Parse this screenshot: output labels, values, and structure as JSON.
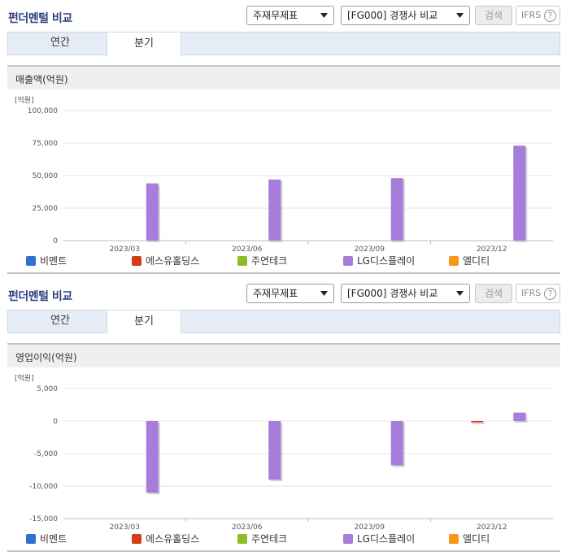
{
  "panels": [
    {
      "title": "펀더멘털 비교",
      "report_select": "주재무제표",
      "group_select": "[FG000] 경쟁사 비교",
      "search_label": "검색",
      "ifrs_label": "IFRS",
      "help_glyph": "?",
      "tabs": [
        "연간",
        "분기"
      ],
      "active_tab": "분기",
      "section_title": "매출액(억원)",
      "unit_label": "[억원]",
      "legend": [
        {
          "name": "비멘트",
          "color": "#2f6fd6"
        },
        {
          "name": "에스유홀딩스",
          "color": "#d93a1b"
        },
        {
          "name": "주연테크",
          "color": "#8dbe24"
        },
        {
          "name": "LG디스플레이",
          "color": "#a77ddb"
        },
        {
          "name": "엘디티",
          "color": "#f59a16"
        }
      ],
      "chart_data": {
        "type": "bar",
        "categories": [
          "2023/03",
          "2023/06",
          "2023/09",
          "2023/12"
        ],
        "y_ticks": [
          "100,000",
          "75,000",
          "50,000",
          "25,000",
          "0"
        ],
        "ylim": [
          0,
          100000
        ],
        "series": [
          {
            "name": "LG디스플레이",
            "color": "#a77ddb",
            "values": [
              44000,
              47000,
              48000,
              73000
            ]
          }
        ]
      }
    },
    {
      "title": "펀더멘털 비교",
      "report_select": "주재무제표",
      "group_select": "[FG000] 경쟁사 비교",
      "search_label": "검색",
      "ifrs_label": "IFRS",
      "help_glyph": "?",
      "tabs": [
        "연간",
        "분기"
      ],
      "active_tab": "분기",
      "section_title": "영업이익(억원)",
      "unit_label": "[억원]",
      "legend": [
        {
          "name": "비멘트",
          "color": "#2f6fd6"
        },
        {
          "name": "에스유홀딩스",
          "color": "#d93a1b"
        },
        {
          "name": "주연테크",
          "color": "#8dbe24"
        },
        {
          "name": "LG디스플레이",
          "color": "#a77ddb"
        },
        {
          "name": "엘디티",
          "color": "#f59a16"
        }
      ],
      "chart_data": {
        "type": "bar",
        "categories": [
          "2023/03",
          "2023/06",
          "2023/09",
          "2023/12"
        ],
        "y_ticks": [
          "5,000",
          "0",
          "-5,000",
          "-10,000",
          "-15,000"
        ],
        "ylim": [
          -15000,
          5000
        ],
        "series": [
          {
            "name": "에스유홀딩스",
            "color": "#d93a1b",
            "values": [
              0,
              0,
              0,
              -200
            ]
          },
          {
            "name": "LG디스플레이",
            "color": "#a77ddb",
            "values": [
              -11000,
              -9000,
              -6800,
              1300
            ]
          }
        ]
      }
    }
  ]
}
